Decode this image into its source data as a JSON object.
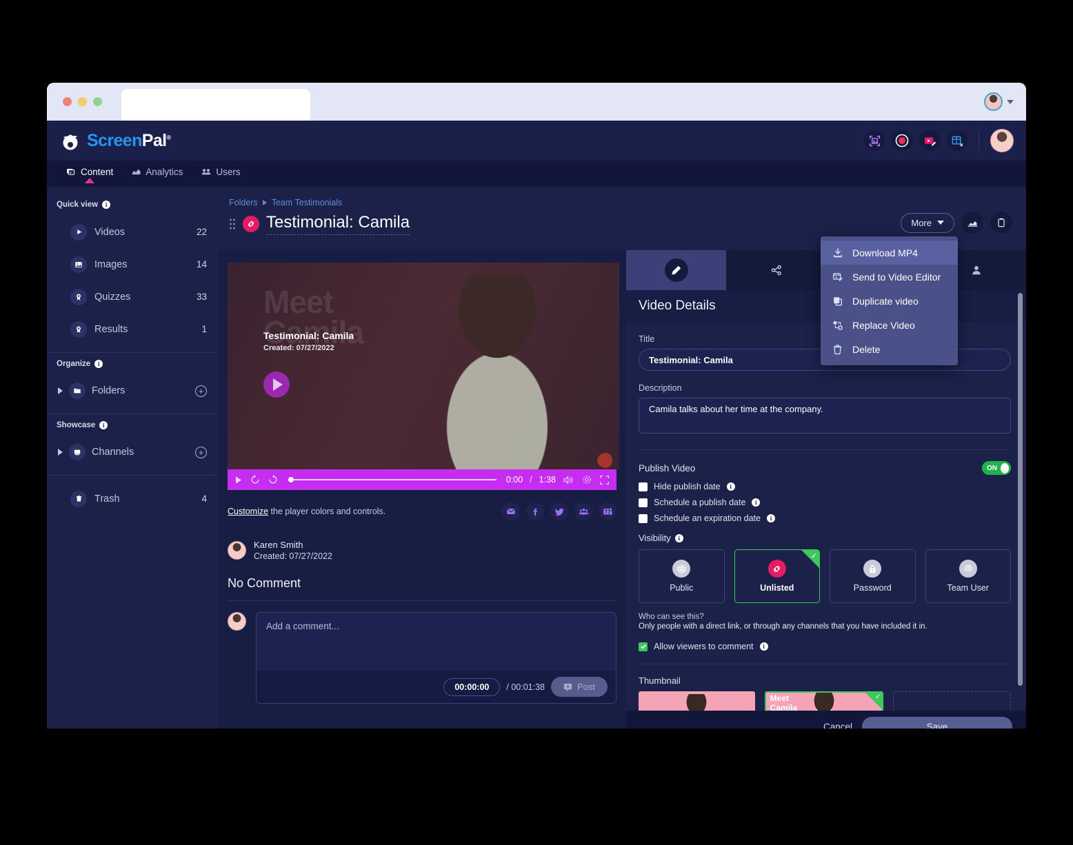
{
  "browser": {
    "tab_title": "",
    "traffic_lights": [
      "close-red",
      "minimize-yellow",
      "maximize-green"
    ]
  },
  "header": {
    "brand_primary": "Screen",
    "brand_secondary": "Pal",
    "brand_registered": "®",
    "brand_color_primary": "#2196f3",
    "brand_color_secondary": "#ffffff",
    "icons": [
      "screenshot-icon",
      "record-icon",
      "video-editor-icon",
      "grid-add-icon"
    ],
    "avatar": "user-avatar"
  },
  "nav": {
    "tabs": [
      {
        "label": "Content",
        "icon": "content-icon",
        "active": true
      },
      {
        "label": "Analytics",
        "icon": "analytics-icon",
        "active": false
      },
      {
        "label": "Users",
        "icon": "users-icon",
        "active": false
      }
    ],
    "active_indicator_color": "#e0368a"
  },
  "sidebar": {
    "quick_view_label": "Quick view",
    "quick_view_items": [
      {
        "label": "Videos",
        "count": "22",
        "icon": "play-icon"
      },
      {
        "label": "Images",
        "count": "14",
        "icon": "image-icon"
      },
      {
        "label": "Quizzes",
        "count": "33",
        "icon": "badge-icon"
      },
      {
        "label": "Results",
        "count": "1",
        "icon": "badge-icon"
      }
    ],
    "organize_label": "Organize",
    "organize_items": [
      {
        "label": "Folders",
        "icon": "folder-icon"
      }
    ],
    "showcase_label": "Showcase",
    "showcase_items": [
      {
        "label": "Channels",
        "icon": "channel-icon"
      }
    ],
    "trash": {
      "label": "Trash",
      "count": "4",
      "icon": "trash-icon"
    }
  },
  "breadcrumb": {
    "root": "Folders",
    "current": "Team Testimonials"
  },
  "page": {
    "title": "Testimonial: Camila",
    "link_badge_icon": "link-icon",
    "grip_icon": "drag-grip-icon",
    "more_button": "More",
    "analytics_button_icon": "analytics-chart-icon",
    "clipboard_button_icon": "clipboard-icon"
  },
  "more_menu": {
    "items": [
      {
        "label": "Download MP4",
        "icon": "download-icon",
        "highlighted": true
      },
      {
        "label": "Send to Video Editor",
        "icon": "video-editor-icon",
        "highlighted": false
      },
      {
        "label": "Duplicate video",
        "icon": "duplicate-icon",
        "highlighted": false
      },
      {
        "label": "Replace Video",
        "icon": "replace-icon",
        "highlighted": false
      },
      {
        "label": "Delete",
        "icon": "trash-icon",
        "highlighted": false
      }
    ]
  },
  "player": {
    "poster_bg_text": "Meet Camila",
    "poster_bg_line1": "Meet",
    "poster_bg_line2": "Camila",
    "overlay_title": "Testimonial: Camila",
    "overlay_created": "Created: 07/27/2022",
    "play_button_icon": "play-icon",
    "controls": {
      "play_icon": "play-icon",
      "rewind_icon": "rewind-10-icon",
      "forward_icon": "forward-10-icon",
      "current_time": "0:00",
      "separator": "/",
      "duration": "1:38",
      "volume_icon": "volume-icon",
      "settings_icon": "gear-icon",
      "fullscreen_icon": "fullscreen-icon",
      "accent_color": "#c52ef0"
    }
  },
  "customize": {
    "link_text": "Customize",
    "rest_text": " the player colors and controls.",
    "share_icons": [
      "email-icon",
      "facebook-icon",
      "twitter-icon",
      "group-icon",
      "microsoft-teams-icon"
    ]
  },
  "author": {
    "name": "Karen Smith",
    "created": "Created: 07/27/2022",
    "avatar": "user-avatar"
  },
  "comments": {
    "heading": "No Comment",
    "placeholder": "Add a comment...",
    "timestamp": "00:00:00",
    "total_time": "/ 00:01:38",
    "post_label": "Post",
    "post_icon": "comment-add-icon",
    "avatar": "user-avatar"
  },
  "details_panel": {
    "tabs": [
      {
        "icon": "pencil-icon",
        "name": "details-tab",
        "active": true
      },
      {
        "icon": "share-icon",
        "name": "share-tab",
        "active": false
      },
      {
        "icon": "captions-icon",
        "name": "captions-tab",
        "active": false
      },
      {
        "icon": "person-icon",
        "name": "permissions-tab",
        "active": false
      }
    ],
    "title": "Video Details",
    "title_label": "Title",
    "title_value": "Testimonial: Camila",
    "description_label": "Description",
    "description_value": "Camila talks about her time at the company.",
    "publish_label": "Publish Video",
    "publish_toggle": "ON",
    "publish_toggle_color": "#22b24c",
    "checkboxes": [
      {
        "label": "Hide publish date",
        "checked": false
      },
      {
        "label": "Schedule a publish date",
        "checked": false
      },
      {
        "label": "Schedule an expiration date",
        "checked": false
      }
    ],
    "visibility_label": "Visibility",
    "visibility_options": [
      {
        "label": "Public",
        "icon": "globe-icon",
        "selected": false
      },
      {
        "label": "Unlisted",
        "icon": "link-icon",
        "selected": true
      },
      {
        "label": "Password",
        "icon": "lock-icon",
        "selected": false
      },
      {
        "label": "Team User",
        "icon": "fingerprint-icon",
        "selected": false
      }
    ],
    "who_title": "Who can see this?",
    "who_desc": "Only people with a direct link, or through any channels that you have included it in.",
    "allow_comment": {
      "label": "Allow viewers to comment",
      "checked": true
    },
    "thumbnail_label": "Thumbnail",
    "thumbnails": [
      {
        "caption": "",
        "selected": false
      },
      {
        "caption_line1": "Meet",
        "caption_line2": "Camila",
        "selected": true
      },
      {
        "caption": "",
        "selected": false,
        "empty": true
      }
    ],
    "cancel_label": "Cancel",
    "save_label": "Save"
  }
}
